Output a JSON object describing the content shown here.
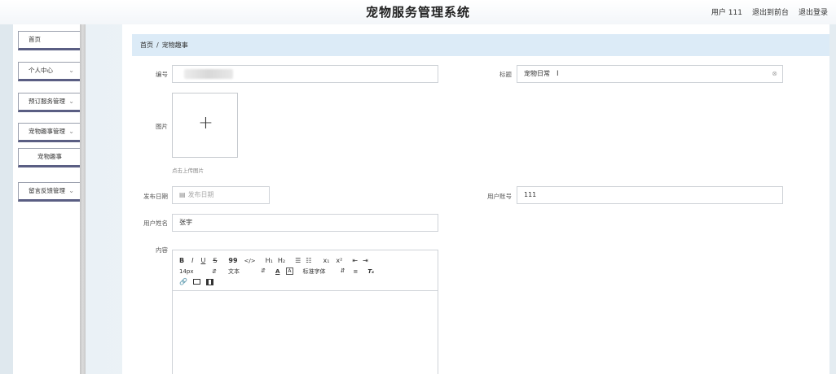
{
  "header": {
    "title": "宠物服务管理系统",
    "user": "用户 111",
    "back_frontend": "退出到前台",
    "logout": "退出登录"
  },
  "sidebar": {
    "items": [
      {
        "label": "首页"
      },
      {
        "label": "个人中心"
      },
      {
        "label": "预订服务管理"
      },
      {
        "label": "宠物趣事管理"
      },
      {
        "label": "宠物趣事"
      },
      {
        "label": "留言反馈管理"
      }
    ]
  },
  "breadcrumb": {
    "home": "首页",
    "sep": "/",
    "current": "宠物趣事"
  },
  "form": {
    "id_label": "编号",
    "title_label": "标题",
    "title_value": "宠物日常",
    "image_label": "图片",
    "upload_hint": "点击上传图片",
    "publish_date_label": "发布日期",
    "publish_date_placeholder": "发布日期",
    "account_label": "用户账号",
    "account_value": "111",
    "username_label": "用户姓名",
    "username_value": "张宇",
    "content_label": "内容"
  },
  "editor": {
    "row1": [
      "B",
      "I",
      "U",
      "S",
      "99",
      "</>",
      "H₁",
      "H₂",
      "☰",
      "☷",
      "x₁",
      "x²",
      "⇤",
      "⇥"
    ],
    "row2": {
      "font_size": "14px",
      "block": "文本",
      "font_family": "标准字体"
    },
    "row3": [
      "link",
      "image",
      "video"
    ]
  },
  "colors": {
    "breadcrumb_bg": "#dcebf7",
    "sidebar_accent": "#5a5e83"
  }
}
